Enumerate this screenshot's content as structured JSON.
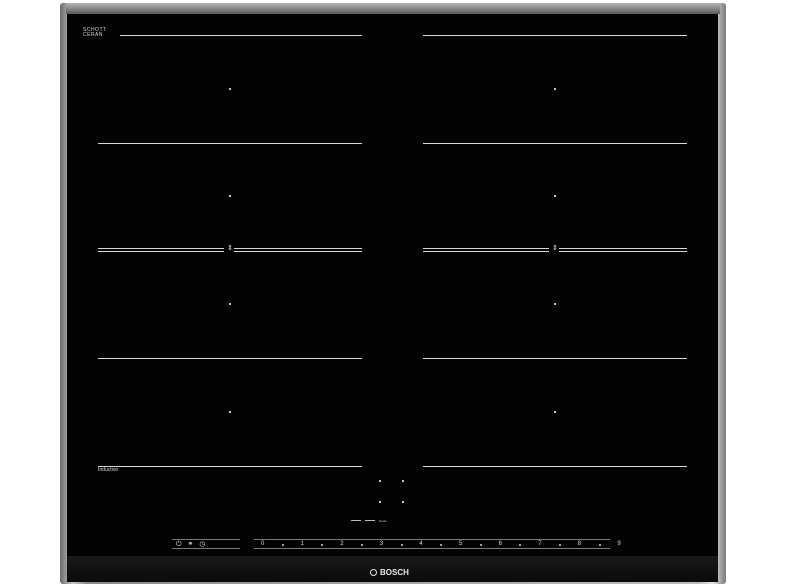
{
  "branding": {
    "glass_logo": "SCHOTT",
    "glass_logo_sub": "CERAN",
    "brand": "BOSCH"
  },
  "zone_label": "Induction",
  "controls": {
    "left_icons": [
      "power-icon",
      "child-lock-icon",
      "timer-icon"
    ],
    "boost_label": "boost"
  },
  "power_slider": {
    "levels": [
      "0",
      "1",
      "2",
      "3",
      "4",
      "5",
      "6",
      "7",
      "8",
      "9"
    ]
  },
  "colors": {
    "glass": "#030303",
    "markings": "#d8d8d8",
    "frame": "#bdbdbd"
  }
}
